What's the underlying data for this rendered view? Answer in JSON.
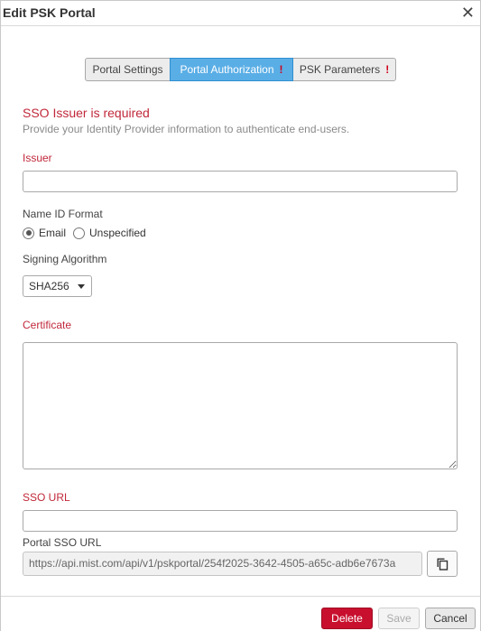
{
  "dialog": {
    "title": "Edit PSK Portal",
    "close_glyph": "✕"
  },
  "tabs": [
    {
      "label": "Portal Settings",
      "warning": ""
    },
    {
      "label": "Portal Authorization",
      "warning": "!"
    },
    {
      "label": "PSK Parameters",
      "warning": "!"
    }
  ],
  "active_tab": "Portal Authorization",
  "form": {
    "error_title": "SSO Issuer is required",
    "hint": "Provide your Identity Provider information to authenticate end-users.",
    "issuer_label": "Issuer",
    "issuer_value": "",
    "name_id_label": "Name ID Format",
    "name_id_options": [
      "Email",
      "Unspecified"
    ],
    "name_id_selected": "Email",
    "signing_label": "Signing Algorithm",
    "signing_value": "SHA256",
    "certificate_label": "Certificate",
    "certificate_value": "",
    "sso_url_label": "SSO URL",
    "sso_url_value": "",
    "portal_sso_label": "Portal SSO URL",
    "portal_sso_value": "https://api.mist.com/api/v1/pskportal/254f2025-3642-4505-a65c-adb6e7673a"
  },
  "footer": {
    "delete_label": "Delete",
    "save_label": "Save",
    "cancel_label": "Cancel"
  },
  "colors": {
    "accent": "#5aaee6",
    "error": "#c0283a",
    "delete": "#c8102e"
  },
  "icons": {
    "close": "close-icon",
    "copy": "copy-icon",
    "dropdown": "chevron-down-icon",
    "warning": "warning-icon"
  }
}
